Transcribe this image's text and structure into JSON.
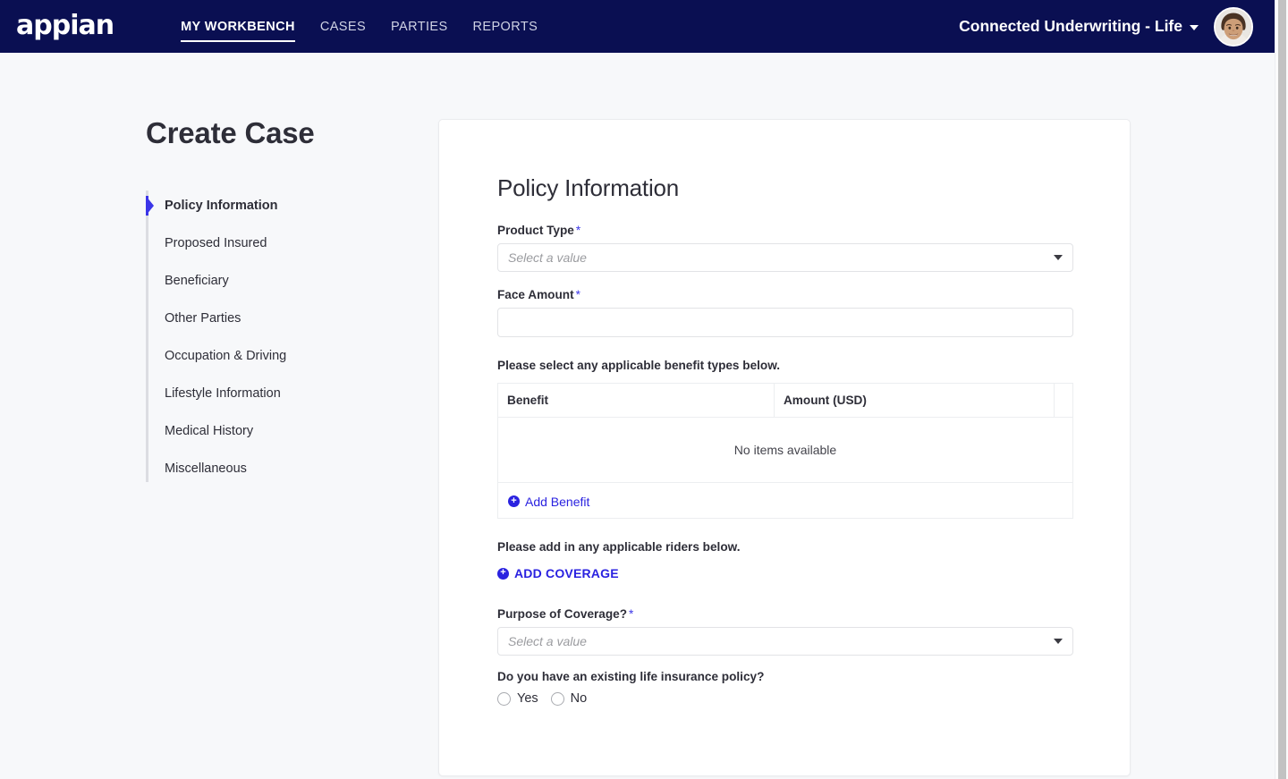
{
  "topbar": {
    "logo_text": "appian",
    "nav_items": [
      {
        "label": "MY WORKBENCH",
        "active": true
      },
      {
        "label": "CASES",
        "active": false
      },
      {
        "label": "PARTIES",
        "active": false
      },
      {
        "label": "REPORTS",
        "active": false
      }
    ],
    "site_title": "Connected Underwriting - Life",
    "brand_color": "#0a0f52"
  },
  "left": {
    "page_title": "Create Case",
    "steps": [
      {
        "label": "Policy Information",
        "active": true
      },
      {
        "label": "Proposed Insured",
        "active": false
      },
      {
        "label": "Beneficiary",
        "active": false
      },
      {
        "label": "Other Parties",
        "active": false
      },
      {
        "label": "Occupation & Driving",
        "active": false
      },
      {
        "label": "Lifestyle Information",
        "active": false
      },
      {
        "label": "Medical History",
        "active": false
      },
      {
        "label": "Miscellaneous",
        "active": false
      }
    ],
    "active_marker_color": "#3b35e8"
  },
  "form": {
    "section_title": "Policy Information",
    "product_type": {
      "label": "Product Type",
      "required_mark": "*",
      "placeholder": "Select a value",
      "value": ""
    },
    "face_amount": {
      "label": "Face Amount",
      "required_mark": "*",
      "value": ""
    },
    "benefits_helper": "Please select any applicable benefit types below.",
    "benefit_table": {
      "columns": [
        "Benefit",
        "Amount (USD)",
        ""
      ],
      "rows": [],
      "empty_text": "No items available",
      "add_label": "Add Benefit"
    },
    "riders_helper": "Please add in any applicable riders below.",
    "add_coverage_label": "ADD COVERAGE",
    "purpose_of_coverage": {
      "label": "Purpose of Coverage?",
      "required_mark": "*",
      "placeholder": "Select a value",
      "value": ""
    },
    "existing_policy": {
      "label": "Do you have an existing life insurance policy?",
      "options": [
        {
          "label": "Yes",
          "selected": false
        },
        {
          "label": "No",
          "selected": false
        }
      ]
    },
    "link_color": "#2a22e0",
    "required_color": "#3b35e8"
  }
}
